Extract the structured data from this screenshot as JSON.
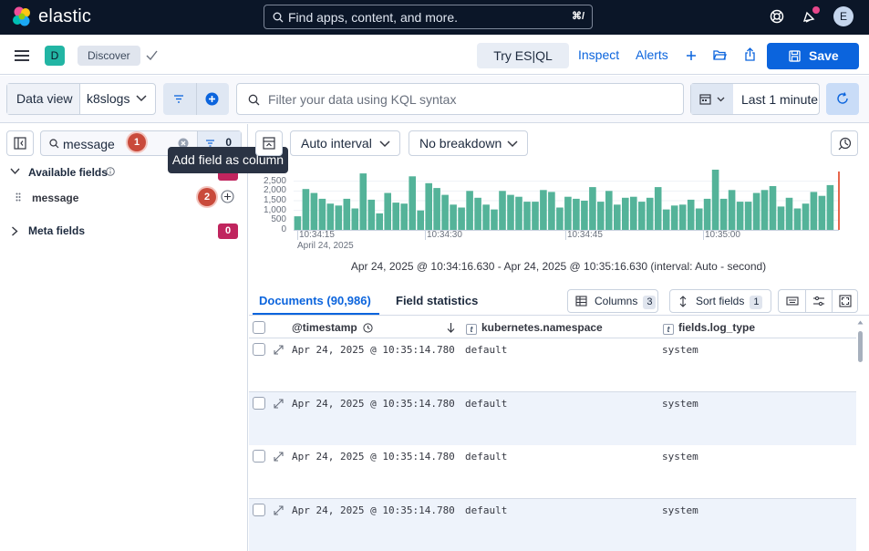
{
  "header": {
    "brand": "elastic",
    "search_placeholder": "Find apps, content, and more.",
    "search_shortcut": "⌘/",
    "avatar_initial": "E"
  },
  "appbar": {
    "space_initial": "D",
    "breadcrumb": "Discover",
    "try_esql": "Try ES|QL",
    "inspect": "Inspect",
    "alerts": "Alerts",
    "save": "Save"
  },
  "querybar": {
    "data_view_label": "Data view",
    "data_view_value": "k8slogs",
    "kql_placeholder": "Filter your data using KQL syntax",
    "time_range": "Last 1 minute"
  },
  "sidebar": {
    "search_value": "message",
    "filter_count": "0",
    "available_fields_label": "Available fields",
    "field_name": "message",
    "meta_fields_label": "Meta fields",
    "meta_fields_count": "0",
    "tooltip": "Add field as column",
    "step1": "1",
    "step2": "2"
  },
  "chart_controls": {
    "interval": "Auto interval",
    "breakdown": "No breakdown"
  },
  "chart_data": {
    "type": "bar",
    "y_ticks": [
      "2,500",
      "2,000",
      "1,500",
      "1,000",
      "500",
      "0"
    ],
    "ylim": [
      0,
      3000
    ],
    "x_ticks": [
      "10:34:15",
      "10:34:30",
      "10:34:45",
      "10:35:00"
    ],
    "x_subtick": "April 24, 2025",
    "color": "#54b399",
    "values": [
      700,
      2100,
      1900,
      1600,
      1350,
      1250,
      1600,
      1100,
      2900,
      1550,
      850,
      1900,
      1400,
      1350,
      2750,
      1000,
      2400,
      2150,
      1800,
      1300,
      1150,
      2000,
      1650,
      1300,
      1050,
      2000,
      1800,
      1700,
      1450,
      1450,
      2050,
      1950,
      1150,
      1700,
      1600,
      1500,
      2200,
      1450,
      2000,
      1300,
      1650,
      1700,
      1450,
      1650,
      2200,
      1050,
      1250,
      1300,
      1550,
      1100,
      1600,
      3150,
      1600,
      2050,
      1450,
      1450,
      1900,
      2050,
      2250,
      1200,
      1650,
      1100,
      1350,
      1950,
      1750,
      2300
    ]
  },
  "time_summary": "Apr 24, 2025 @ 10:34:16.630 - Apr 24, 2025 @ 10:35:16.630 (interval: Auto - second)",
  "tabs": {
    "documents": "Documents (90,986)",
    "field_stats": "Field statistics"
  },
  "toolbar": {
    "columns": "Columns",
    "columns_count": "3",
    "sort_fields": "Sort fields",
    "sort_count": "1"
  },
  "grid": {
    "columns": [
      "@timestamp",
      "kubernetes.namespace",
      "fields.log_type"
    ],
    "type_badge": "t",
    "rows": [
      {
        "timestamp": "Apr 24, 2025 @ 10:35:14.780",
        "namespace": "default",
        "log_type": "system"
      },
      {
        "timestamp": "Apr 24, 2025 @ 10:35:14.780",
        "namespace": "default",
        "log_type": "system"
      },
      {
        "timestamp": "Apr 24, 2025 @ 10:35:14.780",
        "namespace": "default",
        "log_type": "system"
      },
      {
        "timestamp": "Apr 24, 2025 @ 10:35:14.780",
        "namespace": "default",
        "log_type": "system"
      }
    ]
  }
}
